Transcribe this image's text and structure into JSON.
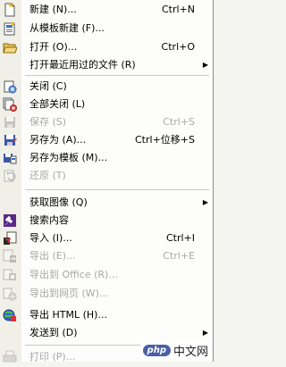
{
  "menu": {
    "items": [
      {
        "label": "新建 (N)...",
        "shortcut": "Ctrl+N",
        "icon": "new-document-icon",
        "disabled": false,
        "submenu": false
      },
      {
        "label": "从模板新建 (F)...",
        "shortcut": "",
        "icon": "template-new-icon",
        "disabled": false,
        "submenu": false
      },
      {
        "label": "打开 (O)...",
        "shortcut": "Ctrl+O",
        "icon": "open-folder-icon",
        "disabled": false,
        "submenu": false
      },
      {
        "label": "打开最近用过的文件 (R)",
        "shortcut": "",
        "icon": "",
        "disabled": false,
        "submenu": true
      },
      {
        "label": "关闭 (C)",
        "shortcut": "",
        "icon": "close-document-icon",
        "disabled": false,
        "submenu": false
      },
      {
        "label": "全部关闭 (L)",
        "shortcut": "",
        "icon": "close-all-icon",
        "disabled": false,
        "submenu": false
      },
      {
        "label": "保存 (S)",
        "shortcut": "Ctrl+S",
        "icon": "save-icon",
        "disabled": true,
        "submenu": false
      },
      {
        "label": "另存为 (A)...",
        "shortcut": "Ctrl+位移+S",
        "icon": "save-as-icon",
        "disabled": false,
        "submenu": false
      },
      {
        "label": "另存为模板 (M)...",
        "shortcut": "",
        "icon": "save-template-icon",
        "disabled": false,
        "submenu": false
      },
      {
        "label": "还原 (T)",
        "shortcut": "",
        "icon": "revert-icon",
        "disabled": true,
        "submenu": false
      },
      {
        "label": "获取图像 (Q)",
        "shortcut": "",
        "icon": "",
        "disabled": false,
        "submenu": true
      },
      {
        "label": "搜索内容",
        "shortcut": "",
        "icon": "search-content-icon",
        "disabled": false,
        "submenu": false
      },
      {
        "label": "导入 (I)...",
        "shortcut": "Ctrl+I",
        "icon": "import-icon",
        "disabled": false,
        "submenu": false
      },
      {
        "label": "导出 (E)...",
        "shortcut": "Ctrl+E",
        "icon": "export-icon",
        "disabled": true,
        "submenu": false
      },
      {
        "label": "导出到 Office (R)...",
        "shortcut": "",
        "icon": "export-office-icon",
        "disabled": true,
        "submenu": false
      },
      {
        "label": "导出到网页 (W)...",
        "shortcut": "",
        "icon": "export-web-icon",
        "disabled": true,
        "submenu": false
      },
      {
        "label": "导出 HTML (H)...",
        "shortcut": "",
        "icon": "export-html-icon",
        "disabled": false,
        "submenu": false
      },
      {
        "label": "发送到 (D)",
        "shortcut": "",
        "icon": "",
        "disabled": false,
        "submenu": true
      },
      {
        "label": "打印 (P)...",
        "shortcut": "",
        "icon": "print-icon",
        "disabled": true,
        "submenu": false
      }
    ]
  },
  "watermark": {
    "brand": "php",
    "text": "中文网"
  }
}
